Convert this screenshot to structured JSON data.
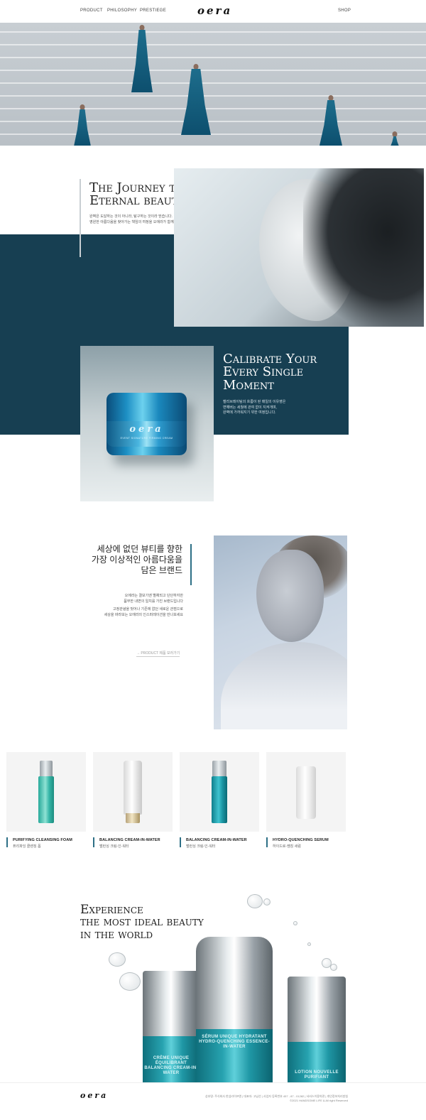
{
  "header": {
    "nav": [
      "PRODUCT",
      "PHILOSOPHY",
      "PRESTIEGE"
    ],
    "logo": "oera",
    "shop": "SHOP"
  },
  "journey": {
    "title_line1": "The Journey to",
    "title_line2": "Eternal beauty",
    "text_line1": "완벽은 도달하는 것이 아니라, 탐구하는 것이라 믿습니다.",
    "text_line2": "영원한 아름다움을 찾아가는 책임의 여정을 오에라가 함께합니다."
  },
  "calibrate": {
    "title_line1": "Calibrate Your",
    "title_line2": "Every Single",
    "title_line3": "Moment",
    "text_line1": "캘리브레이팅의 흐름이 된 매일의 이유영은",
    "text_line2": "변해버는 세월에 관여 없이 지켜개며,",
    "text_line3": "완벽에 가까워지기 위한 여정입니다.",
    "jar_logo": "oera",
    "jar_sub": "EVENT SIGNATURE FIRMING CREAM"
  },
  "brand": {
    "title_line1": "세상에 없던 뷰티를 향한",
    "title_line2": "가장 이상적인 아름다움을",
    "title_line3": "담은 브랜드",
    "text1_line1": "오에라는 결보기엔 별채되고 단단하지만",
    "text1_line2": "품부한 내면의 일치를 가진 브랜드입니다",
    "text2_line1": "고정관념을 벗어나 기존에 없던 새로운 관점으로",
    "text2_line2": "세상을 바라보는 오에라의 인스퍼레이션을 만나보세요",
    "link": "PRODUCT 제품 보러가기"
  },
  "products": [
    {
      "name": "PURIFYING CLEANSING FOAM",
      "ko": "퓨리파잉 클렌징 폼"
    },
    {
      "name": "BALANCING CREAM-IN-WATER",
      "ko": "밸런싱 크림-인-워터"
    },
    {
      "name": "BALANCING CREAM-IN-WATER",
      "ko": "밸런싱 크림-인-워터"
    },
    {
      "name": "HYDRO-QUENCHING SERUM",
      "ko": "하이드로-퀜칭 세럼"
    }
  ],
  "experience": {
    "title_line1": "Experience",
    "title_line2": "the most ideal beauty",
    "title_line3": "in the world",
    "bottle_left_label": "CRÈME UNIQUE ÉQUILIBRANT BALANCING CREAM-IN-WATER",
    "bottle_center_label": "SÉRUM UNIQUE HYDRATANT HYDRO-QUENCHING ESSENCE-IN-WATER",
    "bottle_right_label": "LOTION NOUVELLE PURIFIANT"
  },
  "footer": {
    "logo": "oera",
    "info_line1": "상호명: 주식회사 한섬라이프엔  |  대표자: 고남선  |  사업자 등록번호 457 - 87 - 01282  |  서비스이용약관  |  개인정보처리방침",
    "info_line2": "©2021 HANDSOME LIFE & All right Reserved"
  },
  "colors": {
    "navy": "#173f52",
    "accent": "#2d6f86"
  }
}
